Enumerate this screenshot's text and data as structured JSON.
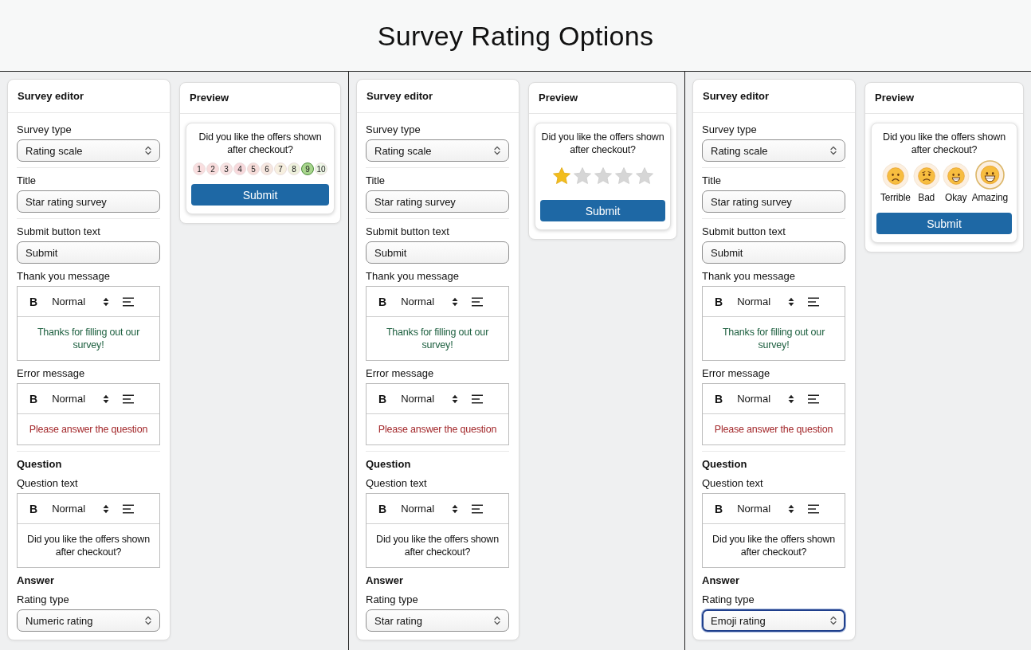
{
  "page_title": "Survey Rating Options",
  "panels": [
    {
      "editor": {
        "title": "Survey editor",
        "sections": [
          {
            "fields": [
              {
                "kind": "select",
                "label": "Survey type",
                "value": "Rating scale",
                "focused": false
              }
            ]
          },
          {
            "fields": [
              {
                "kind": "input",
                "label": "Title",
                "value": "Star rating survey"
              }
            ]
          },
          {
            "fields": [
              {
                "kind": "input",
                "label": "Submit button text",
                "value": "Submit"
              },
              {
                "kind": "rich_text",
                "label": "Thank you message",
                "toolbar": {
                  "bold": "B",
                  "style": "Normal"
                },
                "text": "Thanks for filling out our survey!",
                "color": "#1e6040"
              },
              {
                "kind": "rich_text",
                "label": "Error message",
                "toolbar": {
                  "bold": "B",
                  "style": "Normal"
                },
                "text": "Please answer the question",
                "color": "#a3282b"
              }
            ]
          },
          {
            "fields": [
              {
                "kind": "heading",
                "text": "Question"
              },
              {
                "kind": "rich_text",
                "label": "Question text",
                "toolbar": {
                  "bold": "B",
                  "style": "Normal"
                },
                "text": "Did you like the offers shown after checkout?",
                "color": "#111111"
              },
              {
                "kind": "heading",
                "text": "Answer"
              },
              {
                "kind": "select",
                "label": "Rating type",
                "value": "Numeric rating",
                "focused": false
              }
            ]
          }
        ]
      },
      "preview": {
        "title": "Preview",
        "question": "Did you like the offers shown after checkout?",
        "rating": {
          "kind": "numeric",
          "options": [
            {
              "label": "1",
              "color": "#f9dedf",
              "selected": false
            },
            {
              "label": "2",
              "color": "#f8dcdc",
              "selected": false
            },
            {
              "label": "3",
              "color": "#f8e2e2",
              "selected": false
            },
            {
              "label": "4",
              "color": "#f7d9dc",
              "selected": false
            },
            {
              "label": "5",
              "color": "#f6dcd9",
              "selected": false
            },
            {
              "label": "6",
              "color": "#f6e7e0",
              "selected": false
            },
            {
              "label": "7",
              "color": "#f7f0e0",
              "selected": false
            },
            {
              "label": "8",
              "color": "#eef1dc",
              "selected": false
            },
            {
              "label": "9",
              "color": "#a8d68d",
              "selected": true
            },
            {
              "label": "10",
              "color": "#ecf5e5",
              "selected": false
            }
          ]
        },
        "submit": "Submit"
      }
    },
    {
      "editor": {
        "title": "Survey editor",
        "sections": [
          {
            "fields": [
              {
                "kind": "select",
                "label": "Survey type",
                "value": "Rating scale",
                "focused": false
              }
            ]
          },
          {
            "fields": [
              {
                "kind": "input",
                "label": "Title",
                "value": "Star rating survey"
              }
            ]
          },
          {
            "fields": [
              {
                "kind": "input",
                "label": "Submit button text",
                "value": "Submit"
              },
              {
                "kind": "rich_text",
                "label": "Thank you message",
                "toolbar": {
                  "bold": "B",
                  "style": "Normal"
                },
                "text": "Thanks for filling out our survey!",
                "color": "#1e6040"
              },
              {
                "kind": "rich_text",
                "label": "Error message",
                "toolbar": {
                  "bold": "B",
                  "style": "Normal"
                },
                "text": "Please answer the question",
                "color": "#a3282b"
              }
            ]
          },
          {
            "fields": [
              {
                "kind": "heading",
                "text": "Question"
              },
              {
                "kind": "rich_text",
                "label": "Question text",
                "toolbar": {
                  "bold": "B",
                  "style": "Normal"
                },
                "text": "Did you like the offers shown after checkout?",
                "color": "#111111"
              },
              {
                "kind": "heading",
                "text": "Answer"
              },
              {
                "kind": "select",
                "label": "Rating type",
                "value": "Star rating",
                "focused": false
              }
            ]
          }
        ]
      },
      "preview": {
        "title": "Preview",
        "question": "Did you like the offers shown after checkout?",
        "rating": {
          "kind": "stars",
          "stars": 1
        },
        "submit": "Submit"
      }
    },
    {
      "editor": {
        "title": "Survey editor",
        "sections": [
          {
            "fields": [
              {
                "kind": "select",
                "label": "Survey type",
                "value": "Rating scale",
                "focused": false
              }
            ]
          },
          {
            "fields": [
              {
                "kind": "input",
                "label": "Title",
                "value": "Star rating survey"
              }
            ]
          },
          {
            "fields": [
              {
                "kind": "input",
                "label": "Submit button text",
                "value": "Submit"
              },
              {
                "kind": "rich_text",
                "label": "Thank you message",
                "toolbar": {
                  "bold": "B",
                  "style": "Normal"
                },
                "text": "Thanks for filling out our survey!",
                "color": "#1e6040"
              },
              {
                "kind": "rich_text",
                "label": "Error message",
                "toolbar": {
                  "bold": "B",
                  "style": "Normal"
                },
                "text": "Please answer the question",
                "color": "#a3282b"
              }
            ]
          },
          {
            "fields": [
              {
                "kind": "heading",
                "text": "Question"
              },
              {
                "kind": "rich_text",
                "label": "Question text",
                "toolbar": {
                  "bold": "B",
                  "style": "Normal"
                },
                "text": "Did you like the offers shown after checkout?",
                "color": "#111111"
              },
              {
                "kind": "heading",
                "text": "Answer"
              },
              {
                "kind": "select",
                "label": "Rating type",
                "value": "Emoji rating",
                "focused": true
              }
            ]
          }
        ]
      },
      "preview": {
        "title": "Preview",
        "question": "Did you like the offers shown after checkout?",
        "rating": {
          "kind": "emoji",
          "options": [
            {
              "kind": "frown",
              "label": "Terrible",
              "selected": false
            },
            {
              "kind": "sad",
              "label": "Bad",
              "selected": false
            },
            {
              "kind": "smile",
              "label": "Okay",
              "selected": false
            },
            {
              "kind": "grin",
              "label": "Amazing",
              "selected": true
            }
          ]
        },
        "submit": "Submit"
      }
    }
  ]
}
